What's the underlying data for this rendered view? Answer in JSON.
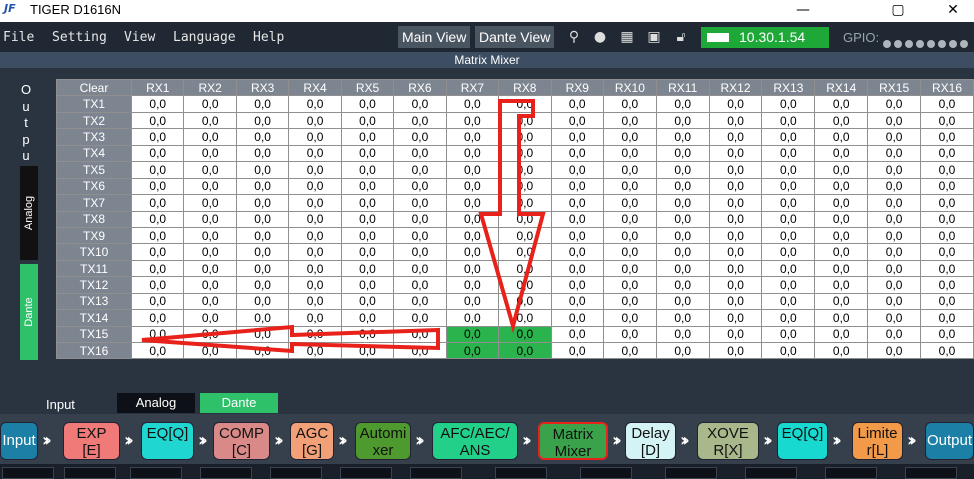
{
  "window": {
    "title": "TIGER D1616N",
    "logo_text": "JF"
  },
  "menu": [
    "File",
    "Setting",
    "View",
    "Language",
    "Help"
  ],
  "toolbar": {
    "main_view": "Main View",
    "dante_view": "Dante View",
    "ip": "10.30.1.54",
    "gpio_label": "GPIO:"
  },
  "panel": {
    "title": "Matrix Mixer"
  },
  "output_side": {
    "letters": [
      "O",
      "u",
      "t",
      "p",
      "u"
    ],
    "analog_tab": "Analog",
    "dante_tab": "Dante"
  },
  "matrix": {
    "corner": "Clear",
    "columns": [
      "RX1",
      "RX2",
      "RX3",
      "RX4",
      "RX5",
      "RX6",
      "RX7",
      "RX8",
      "RX9",
      "RX10",
      "RX11",
      "RX12",
      "RX13",
      "RX14",
      "RX15",
      "RX16"
    ],
    "rows": [
      "TX1",
      "TX2",
      "TX3",
      "TX4",
      "TX5",
      "TX6",
      "TX7",
      "TX8",
      "TX9",
      "TX10",
      "TX11",
      "TX12",
      "TX13",
      "TX14",
      "TX15",
      "TX16"
    ],
    "cell_value": "0,0",
    "highlighted": [
      [
        14,
        6
      ],
      [
        14,
        7
      ],
      [
        15,
        6
      ],
      [
        15,
        7
      ]
    ],
    "highlight_color": "#2bb34d"
  },
  "input_side": {
    "label": "Input",
    "analog_tab": "Analog",
    "dante_tab": "Dante"
  },
  "chain": [
    {
      "label": "Input",
      "color": "#1b7fa6"
    },
    {
      "label": "EXP\n[E]",
      "color": "#f07a78"
    },
    {
      "label": "EQ[Q]",
      "color": "#1fd6d0"
    },
    {
      "label": "COMP\n[C]",
      "color": "#d98a88"
    },
    {
      "label": "AGC\n[G]",
      "color": "#f2a078"
    },
    {
      "label": "Automi\nxer",
      "color": "#4e9a2e"
    },
    {
      "label": "AFC/AEC/\nANS",
      "color": "#22d08a"
    },
    {
      "label": "Matrix\nMixer",
      "color": "#3aa24a"
    },
    {
      "label": "Delay\n[D]",
      "color": "#d3f3f5"
    },
    {
      "label": "XOVE\nR[X]",
      "color": "#a9b88a"
    },
    {
      "label": "EQ[Q]",
      "color": "#18d9cf"
    },
    {
      "label": "Limite\nr[L]",
      "color": "#f39a48"
    },
    {
      "label": "Output",
      "color": "#1b7fa6"
    }
  ],
  "colors": {
    "arrow": "#e8221b",
    "accent_green": "#1ea838"
  }
}
